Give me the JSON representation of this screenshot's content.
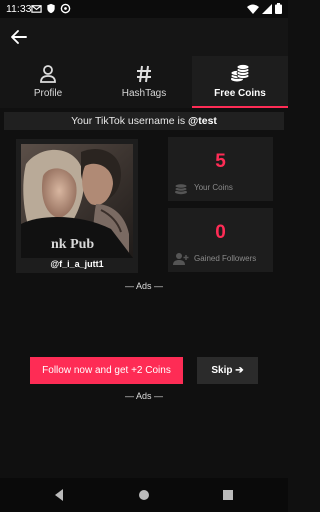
{
  "status_bar": {
    "time": "11:33",
    "left_icons": [
      "gmail-icon",
      "shield-icon",
      "settings-notification-icon"
    ],
    "right_icons": [
      "wifi-icon",
      "signal-icon",
      "battery-icon"
    ]
  },
  "tabs": [
    {
      "label": "Profile",
      "icon": "person-icon",
      "active": false
    },
    {
      "label": "HashTags",
      "icon": "hashtag-icon",
      "active": false
    },
    {
      "label": "Free Coins",
      "icon": "coins-icon",
      "active": true
    }
  ],
  "username_line": {
    "prefix": "Your TikTok username is ",
    "username": "@test"
  },
  "profile": {
    "handle": "@f_i_a_jutt1",
    "photo_text": "nk Pub"
  },
  "stats": {
    "coins": {
      "value": "5",
      "label": "Your Coins"
    },
    "followers": {
      "value": "0",
      "label": "Gained Followers"
    }
  },
  "ads_label_top": "— Ads —",
  "ads_label_bottom": "— Ads —",
  "buttons": {
    "follow": "Follow now and get +2 Coins",
    "skip": "Skip ➔"
  },
  "colors": {
    "accent": "#fe2c55",
    "background": "#101010",
    "card": "#1d1d1d"
  }
}
